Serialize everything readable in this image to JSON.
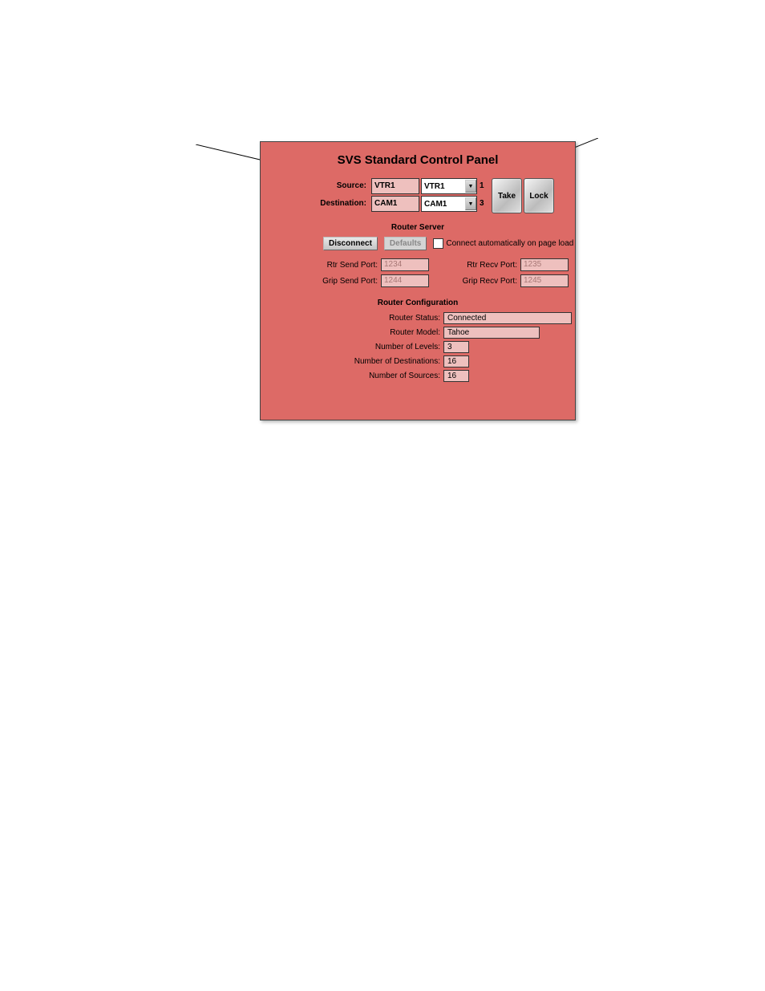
{
  "title": "SVS Standard Control Panel",
  "sourceDest": {
    "sourceLabel": "Source:",
    "destLabel": "Destination:",
    "sourceValue": "VTR1",
    "sourceSelect": "VTR1",
    "sourceNum": "1",
    "destValue": "CAM1",
    "destSelect": "CAM1",
    "destNum": "3",
    "takeLabel": "Take",
    "lockLabel": "Lock"
  },
  "routerServer": {
    "heading": "Router Server",
    "disconnect": "Disconnect",
    "defaults": "Defaults",
    "autoLabel": "Connect automatically on page load",
    "rtrSendLabel": "Rtr Send Port:",
    "rtrSendVal": "1234",
    "rtrRecvLabel": "Rtr Recv Port:",
    "rtrRecvVal": "1235",
    "gripSendLabel": "Grip Send Port:",
    "gripSendVal": "1244",
    "gripRecvLabel": "Grip Recv Port:",
    "gripRecvVal": "1245"
  },
  "routerConfig": {
    "heading": "Router Configuration",
    "statusLabel": "Router Status:",
    "statusVal": "Connected",
    "modelLabel": "Router Model:",
    "modelVal": "Tahoe",
    "levelsLabel": "Number of Levels:",
    "levelsVal": "3",
    "destLabel": "Number of Destinations:",
    "destVal": "16",
    "srcLabel": "Number of Sources:",
    "srcVal": "16"
  }
}
